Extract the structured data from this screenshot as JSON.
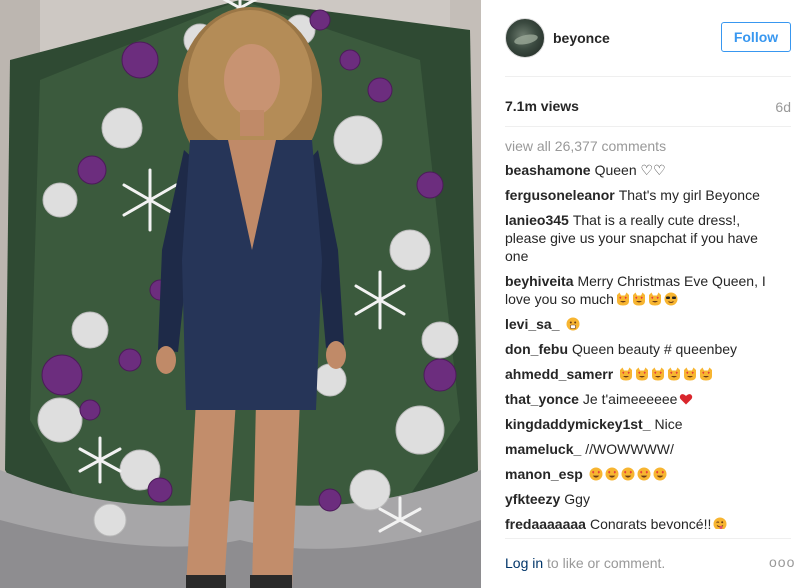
{
  "post": {
    "username": "beyonce",
    "follow_label": "Follow",
    "views": "7.1m views",
    "age": "6d",
    "view_all": "view all 26,377 comments",
    "login_link": "Log in",
    "login_rest": " to like or comment.",
    "more": "ooo"
  },
  "comments": [
    {
      "user": "beashamone",
      "text": "Queen ♡♡",
      "emoji": []
    },
    {
      "user": "fergusoneleanor",
      "text": "That's my girl Beyonce",
      "emoji": []
    },
    {
      "user": "lanieo345",
      "text": "That is a really cute dress!, please give us your snapchat if you have one",
      "emoji": []
    },
    {
      "user": "beyhiveita",
      "text": "Merry Christmas Eve Queen, I love you so much",
      "emoji": [
        "heart-eyes-cat-icon",
        "heart-eyes-cat-icon",
        "heart-eyes-cat-icon",
        "sunglasses-face-icon"
      ]
    },
    {
      "user": "levi_sa_",
      "text": "",
      "emoji": [
        "fearful-face-icon"
      ]
    },
    {
      "user": "don_febu",
      "text": "Queen beauty # queenbey",
      "emoji": []
    },
    {
      "user": "ahmedd_samerr",
      "text": "",
      "emoji": [
        "heart-eyes-cat-icon",
        "heart-eyes-cat-icon",
        "heart-eyes-cat-icon",
        "heart-eyes-cat-icon",
        "heart-eyes-cat-icon",
        "heart-eyes-cat-icon"
      ]
    },
    {
      "user": "that_yonce",
      "text": "Je t'aimeeeeee",
      "emoji": [
        "red-heart-icon"
      ]
    },
    {
      "user": "kingdaddymickey1st_",
      "text": "Nice",
      "emoji": []
    },
    {
      "user": "mameluck_",
      "text": "//WOWWWW/",
      "emoji": []
    },
    {
      "user": "manon_esp",
      "text": "",
      "emoji": [
        "heart-eyes-face-icon",
        "heart-eyes-face-icon",
        "heart-eyes-face-icon",
        "heart-eyes-face-icon",
        "heart-eyes-face-icon"
      ]
    },
    {
      "user": "yfkteezy",
      "text": "Ggy",
      "emoji": []
    },
    {
      "user": "fredaaaaaaa",
      "text": "Congrats beyoncé!!",
      "emoji": [
        "winking-tongue-face-icon"
      ]
    }
  ],
  "colors": {
    "accent": "#3897f0",
    "username": "#262626",
    "muted": "#999999",
    "link": "#003569"
  }
}
